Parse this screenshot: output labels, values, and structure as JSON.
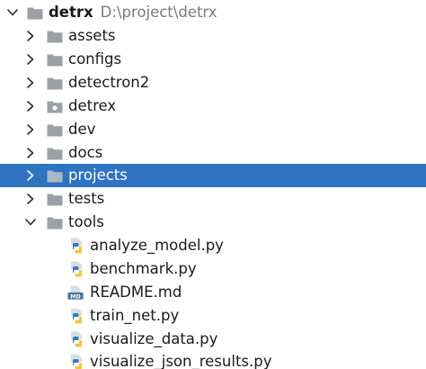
{
  "root": {
    "name": "detrx",
    "path": "D:\\project\\detrx",
    "icon": "folder-icon"
  },
  "folders": [
    {
      "label": "assets",
      "expanded": false,
      "selected": false,
      "icon": "folder-icon"
    },
    {
      "label": "configs",
      "expanded": false,
      "selected": false,
      "icon": "folder-icon"
    },
    {
      "label": "detectron2",
      "expanded": false,
      "selected": false,
      "icon": "folder-icon"
    },
    {
      "label": "detrex",
      "expanded": false,
      "selected": false,
      "icon": "package-folder-icon"
    },
    {
      "label": "dev",
      "expanded": false,
      "selected": false,
      "icon": "folder-icon"
    },
    {
      "label": "docs",
      "expanded": false,
      "selected": false,
      "icon": "folder-icon"
    },
    {
      "label": "projects",
      "expanded": false,
      "selected": true,
      "icon": "folder-icon"
    },
    {
      "label": "tests",
      "expanded": false,
      "selected": false,
      "icon": "folder-icon"
    },
    {
      "label": "tools",
      "expanded": true,
      "selected": false,
      "icon": "folder-icon"
    }
  ],
  "tools_files": [
    {
      "label": "analyze_model.py",
      "icon": "python-file-icon"
    },
    {
      "label": "benchmark.py",
      "icon": "python-file-icon"
    },
    {
      "label": "README.md",
      "icon": "markdown-file-icon"
    },
    {
      "label": "train_net.py",
      "icon": "python-file-icon"
    },
    {
      "label": "visualize_data.py",
      "icon": "python-file-icon"
    },
    {
      "label": "visualize_json_results.py",
      "icon": "python-file-icon"
    }
  ],
  "colors": {
    "selection": "#2f73c1",
    "folder": "#9aa0a6",
    "python_blue": "#3b78b5",
    "python_yellow": "#f2c63a",
    "markdown_blue": "#4a6fa5"
  }
}
